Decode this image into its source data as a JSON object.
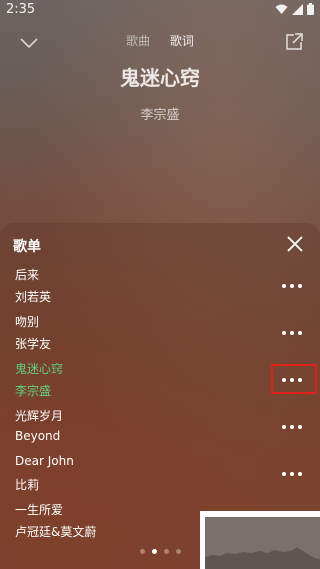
{
  "status_bar": {
    "time": "2:35"
  },
  "header": {
    "tabs": [
      {
        "label": "歌曲",
        "active": false
      },
      {
        "label": "歌词",
        "active": false
      }
    ]
  },
  "now_playing": {
    "title": "鬼迷心窍",
    "artist": "李宗盛"
  },
  "playlist": {
    "title": "歌单",
    "items": [
      {
        "name": "后来",
        "singer": "刘若英"
      },
      {
        "name": "吻别",
        "singer": "张学友"
      },
      {
        "name": "鬼迷心窍",
        "singer": "李宗盛",
        "playing": true
      },
      {
        "name": "光辉岁月",
        "singer": "Beyond"
      },
      {
        "name": "Dear John",
        "singer": "比莉"
      },
      {
        "name": "一生所爱",
        "singer": "卢冠廷&莫文蔚"
      }
    ],
    "page_index": 1,
    "page_count": 4
  },
  "colors": {
    "playing": "#5fd07c",
    "highlight": "#e0201a"
  },
  "icons": [
    "chevron-down-icon",
    "share-icon",
    "close-icon",
    "more-icon",
    "wifi-icon",
    "signal-icon",
    "battery-icon"
  ]
}
